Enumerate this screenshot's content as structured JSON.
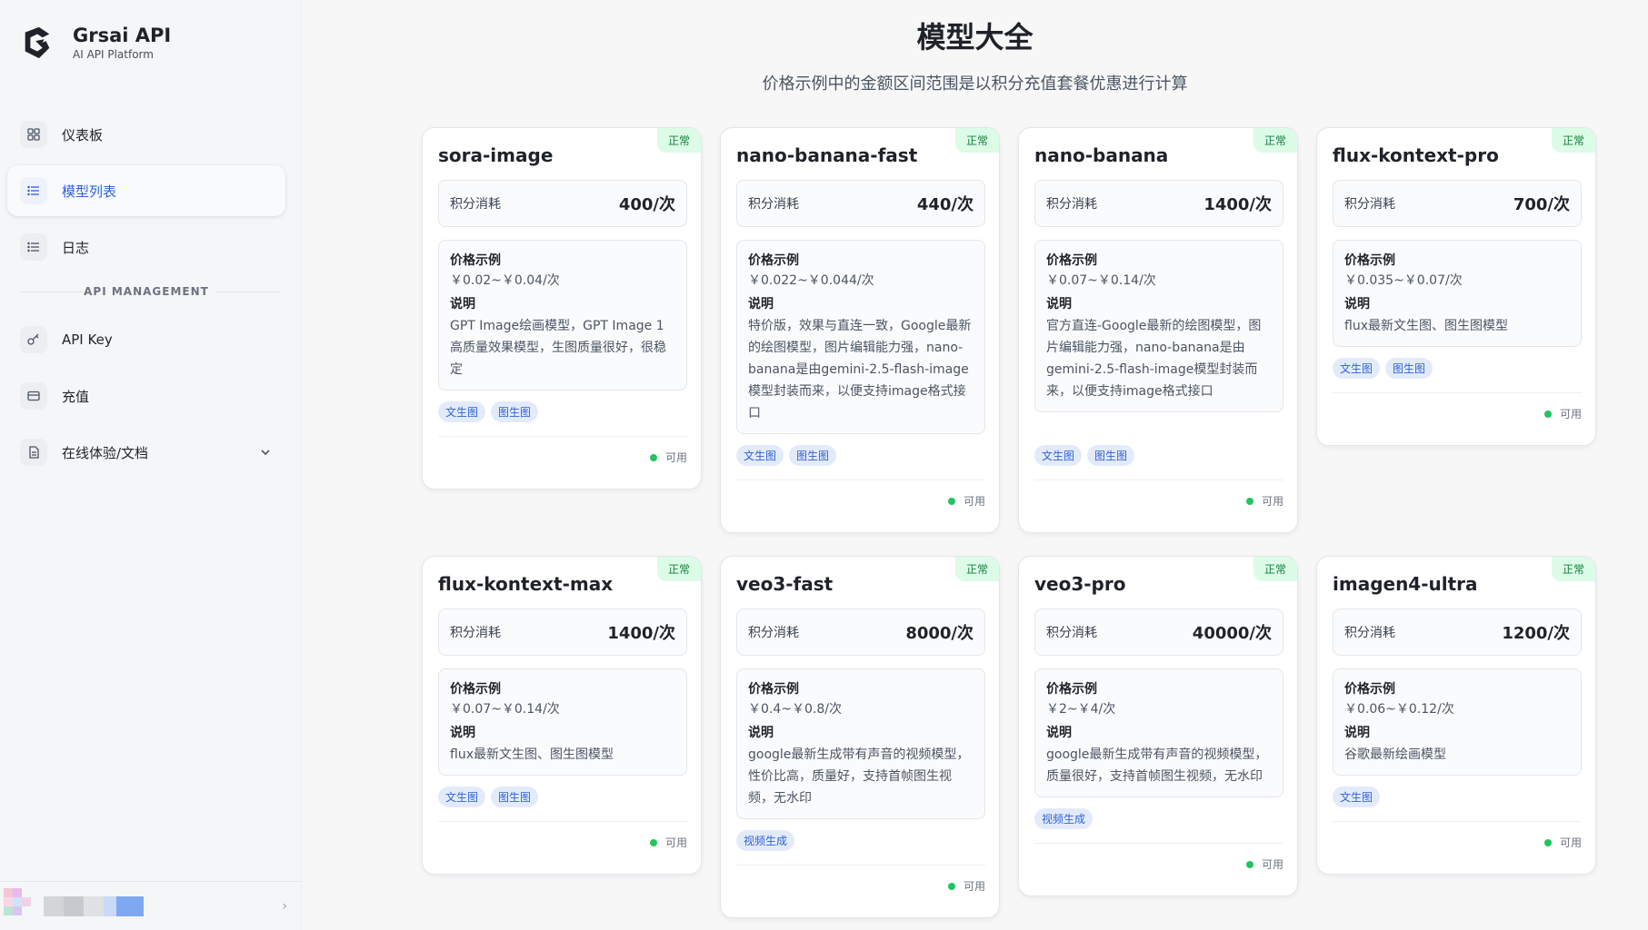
{
  "brand": {
    "title": "Grsai API",
    "subtitle": "AI API Platform"
  },
  "nav": {
    "dashboard": "仪表板",
    "models": "模型列表",
    "logs": "日志",
    "section": "API MANAGEMENT",
    "apikey": "API Key",
    "recharge": "充值",
    "docs": "在线体验/文档"
  },
  "user": {
    "chevron": "›"
  },
  "page": {
    "title": "模型大全",
    "subtitle": "价格示例中的金额区间范围是以积分充值套餐优惠进行计算"
  },
  "labels": {
    "cost": "积分消耗",
    "price_example": "价格示例",
    "desc": "说明"
  },
  "colors": {
    "accent": "#2f62d8",
    "status_ok": "#22c55e",
    "badge_bg": "#dcfce7"
  },
  "cards": [
    {
      "name": "sora-image",
      "status": "正常",
      "cost": "400/次",
      "price": "￥0.02~￥0.04/次",
      "desc": "GPT Image绘画模型，GPT Image 1 高质量效果模型，生图质量很好，很稳定",
      "tags": [
        "文生图",
        "图生图"
      ],
      "availability": "可用"
    },
    {
      "name": "nano-banana-fast",
      "status": "正常",
      "cost": "440/次",
      "price": "￥0.022~￥0.044/次",
      "desc": "特价版，效果与直连一致，Google最新的绘图模型，图片编辑能力强，nano-banana是由gemini-2.5-flash-image模型封装而来，以便支持image格式接口",
      "tags": [
        "文生图",
        "图生图"
      ],
      "availability": "可用"
    },
    {
      "name": "nano-banana",
      "status": "正常",
      "cost": "1400/次",
      "price": "￥0.07~￥0.14/次",
      "desc": "官方直连-Google最新的绘图模型，图片编辑能力强，nano-banana是由gemini-2.5-flash-image模型封装而来，以便支持image格式接口",
      "tags": [
        "文生图",
        "图生图"
      ],
      "availability": "可用"
    },
    {
      "name": "flux-kontext-pro",
      "status": "正常",
      "cost": "700/次",
      "price": "￥0.035~￥0.07/次",
      "desc": "flux最新文生图、图生图模型",
      "tags": [
        "文生图",
        "图生图"
      ],
      "availability": "可用"
    },
    {
      "name": "flux-kontext-max",
      "status": "正常",
      "cost": "1400/次",
      "price": "￥0.07~￥0.14/次",
      "desc": "flux最新文生图、图生图模型",
      "tags": [
        "文生图",
        "图生图"
      ],
      "availability": "可用"
    },
    {
      "name": "veo3-fast",
      "status": "正常",
      "cost": "8000/次",
      "price": "￥0.4~￥0.8/次",
      "desc": "google最新生成带有声音的视频模型，性价比高，质量好，支持首帧图生视频，无水印",
      "tags": [
        "视频生成"
      ],
      "availability": "可用"
    },
    {
      "name": "veo3-pro",
      "status": "正常",
      "cost": "40000/次",
      "price": "￥2~￥4/次",
      "desc": "google最新生成带有声音的视频模型，质量很好，支持首帧图生视频，无水印",
      "tags": [
        "视频生成"
      ],
      "availability": "可用"
    },
    {
      "name": "imagen4-ultra",
      "status": "正常",
      "cost": "1200/次",
      "price": "￥0.06~￥0.12/次",
      "desc": "谷歌最新绘画模型",
      "tags": [
        "文生图"
      ],
      "availability": "可用"
    }
  ]
}
